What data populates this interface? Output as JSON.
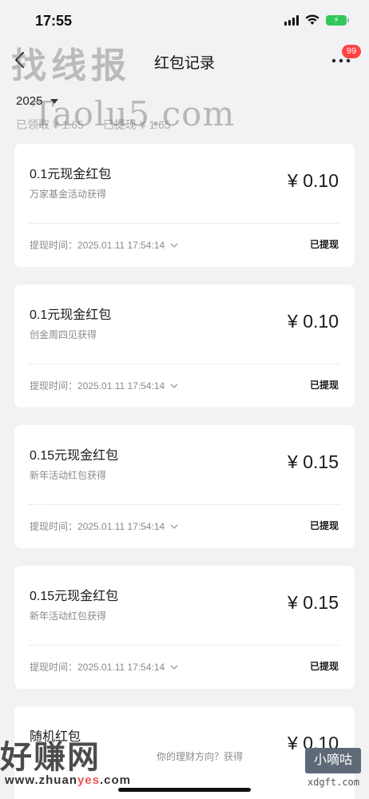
{
  "status_bar": {
    "time": "17:55",
    "battery_icon": "battery-charging-icon",
    "wifi_icon": "wifi-icon",
    "signal_icon": "signal-icon"
  },
  "nav": {
    "title": "红包记录",
    "back_icon": "chevron-left-icon",
    "more_icon": "more-icon",
    "badge": "99"
  },
  "filter": {
    "year": "2025"
  },
  "summary": {
    "received": "已领取 ¥ 1.65",
    "withdrawn": "已提现 ¥ 1.65"
  },
  "records": [
    {
      "title": "0.1元现金红包",
      "source": "万家基金活动获得",
      "amount": "¥ 0.10",
      "time": "提现时间：2025.01.11 17:54:14",
      "status": "已提现"
    },
    {
      "title": "0.1元现金红包",
      "source": "创金周四见获得",
      "amount": "¥ 0.10",
      "time": "提现时间：2025.01.11 17:54:14",
      "status": "已提现"
    },
    {
      "title": "0.15元现金红包",
      "source": "新年活动红包获得",
      "amount": "¥ 0.15",
      "time": "提现时间：2025.01.11 17:54:14",
      "status": "已提现"
    },
    {
      "title": "0.15元现金红包",
      "source": "新年活动红包获得",
      "amount": "¥ 0.15",
      "time": "提现时间：2025.01.11 17:54:14",
      "status": "已提现"
    },
    {
      "title": "随机红包",
      "source": "你的理财方向？获得",
      "amount": "¥ 0.10"
    }
  ],
  "watermarks": {
    "top": "找线报",
    "mid": "Taolu5.com",
    "bottom": "好赚网",
    "url_prefix": "www.zhuan",
    "url_highlight": "yes",
    "url_suffix": ".com",
    "box": "小嘀咕",
    "site": "xdgft.com"
  }
}
